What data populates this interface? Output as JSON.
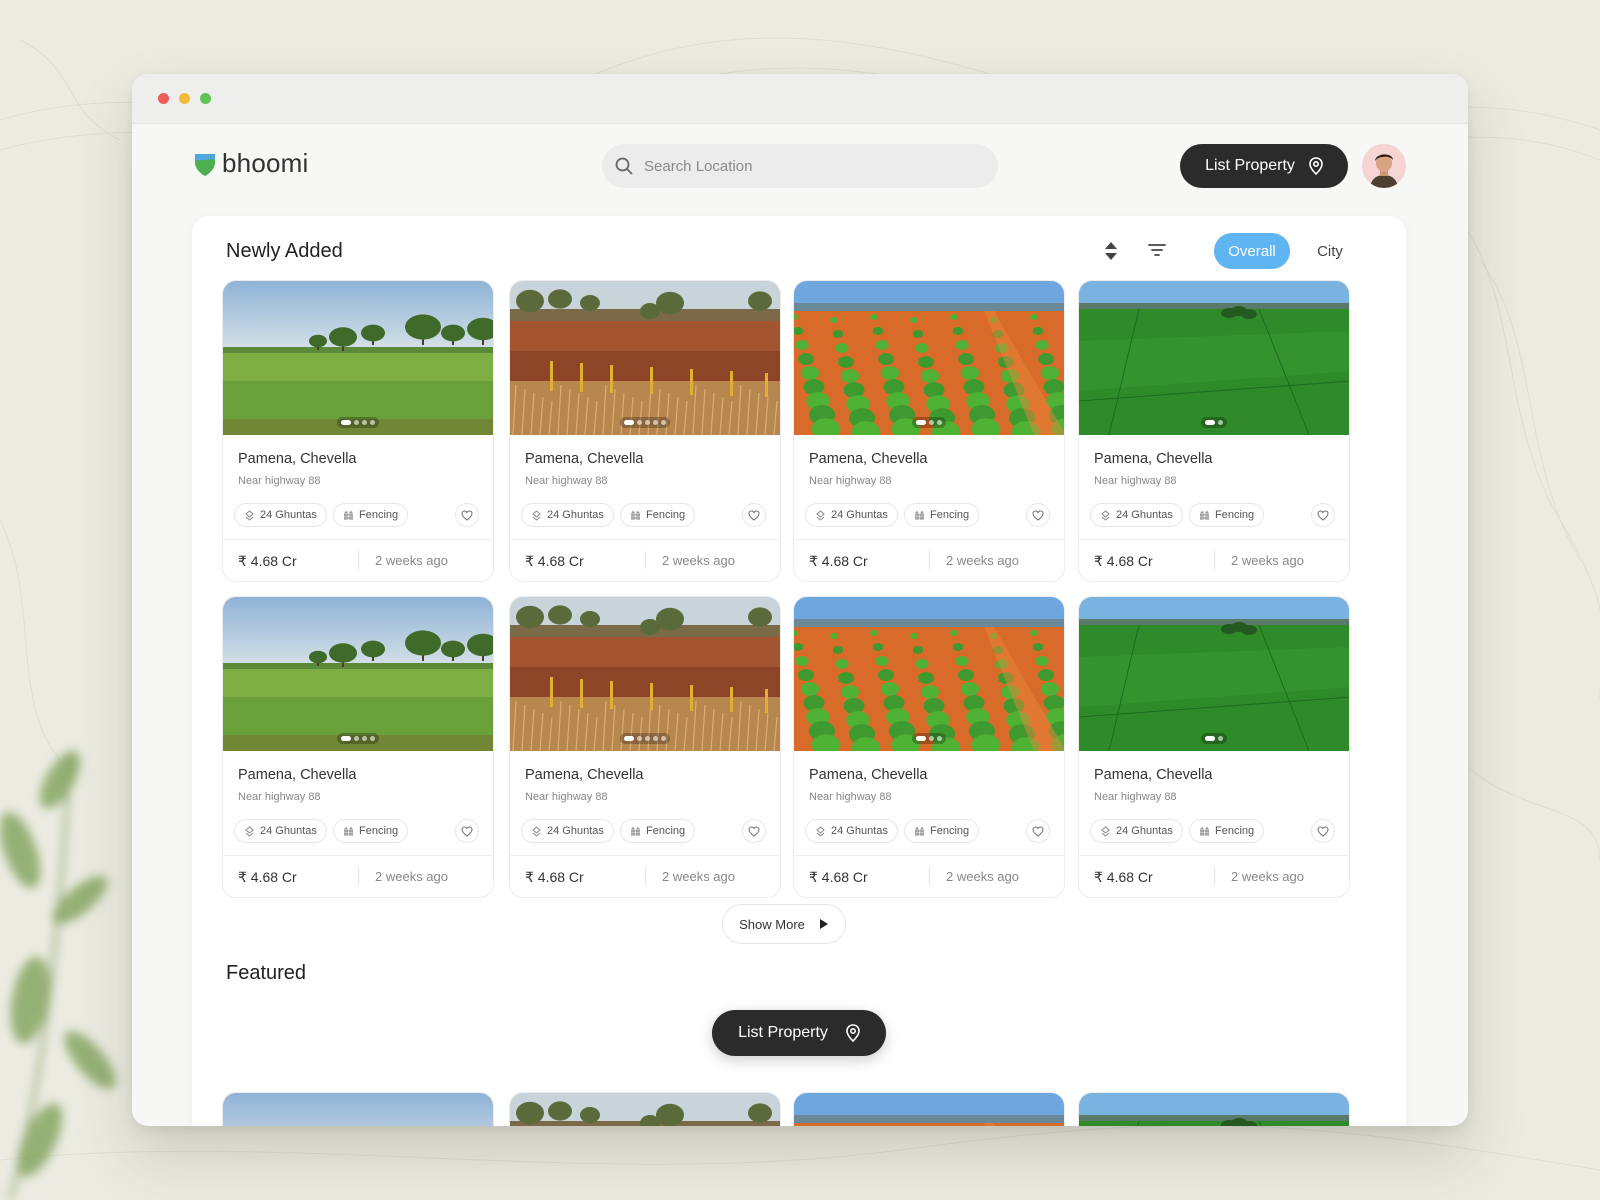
{
  "app": {
    "name": "bhoomi"
  },
  "header": {
    "search_placeholder": "Search Location",
    "list_property_label": "List Property"
  },
  "newly_added": {
    "title": "Newly Added",
    "segments": [
      "Overall",
      "City"
    ],
    "active_segment": "Overall"
  },
  "cards": [
    {
      "location": "Pamena, Chevella",
      "near": "Near highway 88",
      "area": "24 Ghuntas",
      "feature": "Fencing",
      "price": "₹ 4.68 Cr",
      "posted": "2 weeks ago",
      "image": "green-meadow",
      "dots": 4
    },
    {
      "location": "Pamena, Chevella",
      "near": "Near highway 88",
      "area": "24 Ghuntas",
      "feature": "Fencing",
      "price": "₹ 4.68 Cr",
      "posted": "2 weeks ago",
      "image": "red-soil",
      "dots": 5
    },
    {
      "location": "Pamena, Chevella",
      "near": "Near highway 88",
      "area": "24 Ghuntas",
      "feature": "Fencing",
      "price": "₹ 4.68 Cr",
      "posted": "2 weeks ago",
      "image": "orange-rows",
      "dots": 3
    },
    {
      "location": "Pamena, Chevella",
      "near": "Near highway 88",
      "area": "24 Ghuntas",
      "feature": "Fencing",
      "price": "₹ 4.68 Cr",
      "posted": "2 weeks ago",
      "image": "green-fields",
      "dots": 2
    },
    {
      "location": "Pamena, Chevella",
      "near": "Near highway 88",
      "area": "24 Ghuntas",
      "feature": "Fencing",
      "price": "₹ 4.68 Cr",
      "posted": "2 weeks ago",
      "image": "green-meadow",
      "dots": 4
    },
    {
      "location": "Pamena, Chevella",
      "near": "Near highway 88",
      "area": "24 Ghuntas",
      "feature": "Fencing",
      "price": "₹ 4.68 Cr",
      "posted": "2 weeks ago",
      "image": "red-soil",
      "dots": 5
    },
    {
      "location": "Pamena, Chevella",
      "near": "Near highway 88",
      "area": "24 Ghuntas",
      "feature": "Fencing",
      "price": "₹ 4.68 Cr",
      "posted": "2 weeks ago",
      "image": "orange-rows",
      "dots": 3
    },
    {
      "location": "Pamena, Chevella",
      "near": "Near highway 88",
      "area": "24 Ghuntas",
      "feature": "Fencing",
      "price": "₹ 4.68 Cr",
      "posted": "2 weeks ago",
      "image": "green-fields",
      "dots": 2
    }
  ],
  "show_more_label": "Show More",
  "featured": {
    "title": "Featured",
    "images": [
      "green-meadow",
      "red-soil",
      "orange-rows",
      "green-fields"
    ]
  },
  "floating_button_label": "List Property",
  "colors": {
    "accent": "#5fb4f2",
    "dark_button": "#2b2b2b",
    "logo_blue": "#4fa8e0",
    "logo_green": "#4caf50"
  }
}
